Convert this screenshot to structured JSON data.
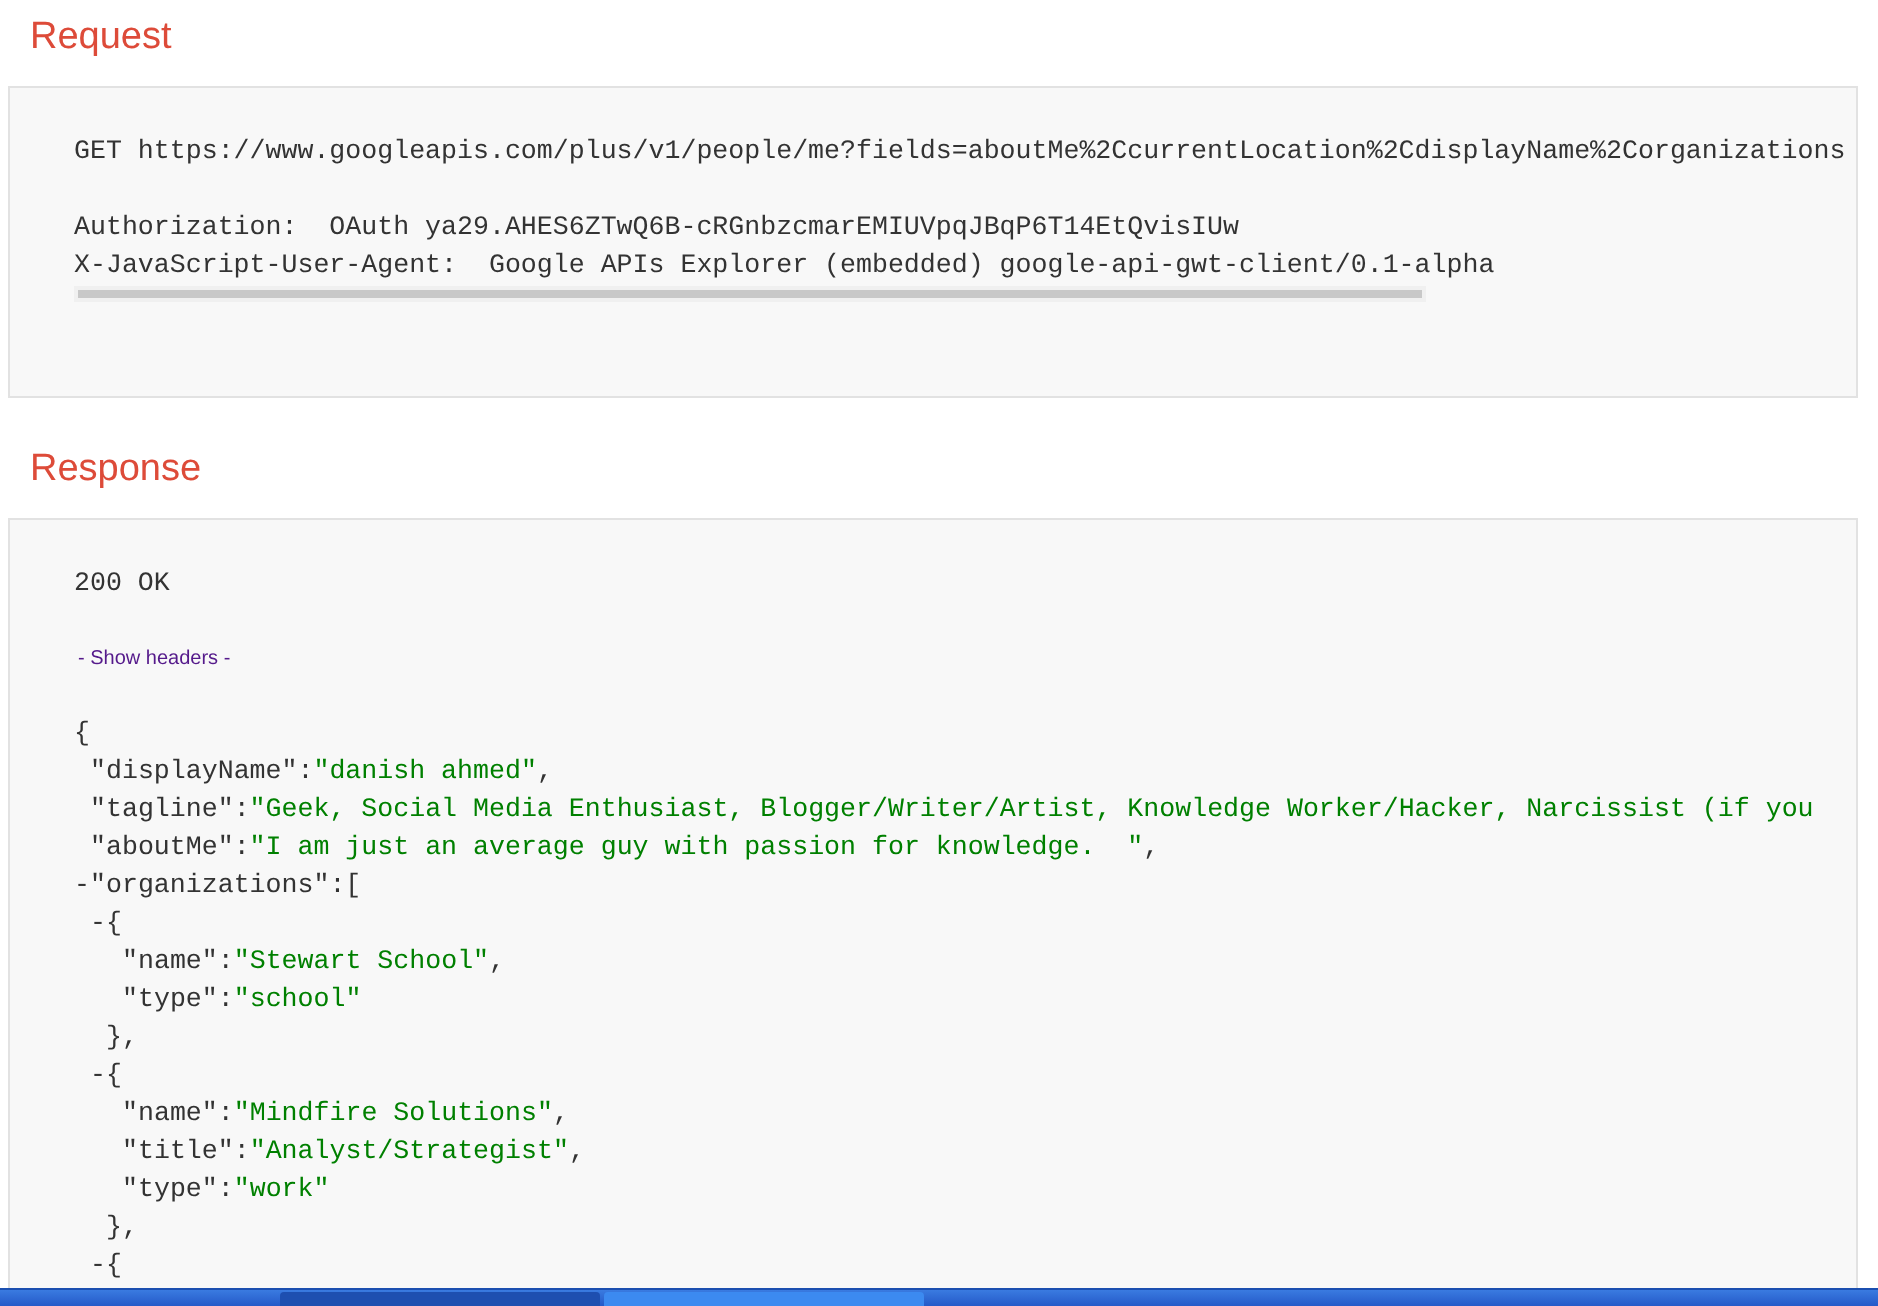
{
  "request": {
    "title": "Request",
    "request_line": "GET https://www.googleapis.com/plus/v1/people/me?fields=aboutMe%2CcurrentLocation%2CdisplayName%2Corganizations",
    "headers": [
      "Authorization:  OAuth ya29.AHES6ZTwQ6B-cRGnbzcmarEMIUVpqJBqP6T14EtQvisIUw",
      "X-JavaScript-User-Agent:  Google APIs Explorer (embedded) google-api-gwt-client/0.1-alpha"
    ]
  },
  "response": {
    "title": "Response",
    "status": "200 OK",
    "headers_link": "- Show headers -",
    "body": {
      "open": "{",
      "children": [
        {
          "key": "\"displayName\":",
          "value": "\"danish ahmed\"",
          "tail": ","
        },
        {
          "key": "\"tagline\":",
          "value": "\"Geek, Social Media Enthusiast, Blogger/Writer/Artist, Knowledge Worker/Hacker, Narcissist (if you"
        },
        {
          "key": "\"aboutMe\":",
          "value": "\"I am just an average guy with passion for knowledge.  \"",
          "tail": ","
        },
        {
          "toggle": "-",
          "key": "\"organizations\":",
          "open": "[",
          "children": [
            {
              "toggle": "-",
              "open": "{",
              "close": "},",
              "children": [
                {
                  "key": "\"name\":",
                  "value": "\"Stewart School\"",
                  "tail": ","
                },
                {
                  "key": "\"type\":",
                  "value": "\"school\""
                }
              ]
            },
            {
              "toggle": "-",
              "open": "{",
              "close": "},",
              "children": [
                {
                  "key": "\"name\":",
                  "value": "\"Mindfire Solutions\"",
                  "tail": ","
                },
                {
                  "key": "\"title\":",
                  "value": "\"Analyst/Strategist\"",
                  "tail": ","
                },
                {
                  "key": "\"type\":",
                  "value": "\"work\""
                }
              ]
            },
            {
              "toggle": "-",
              "open": "{"
            }
          ]
        }
      ]
    }
  }
}
